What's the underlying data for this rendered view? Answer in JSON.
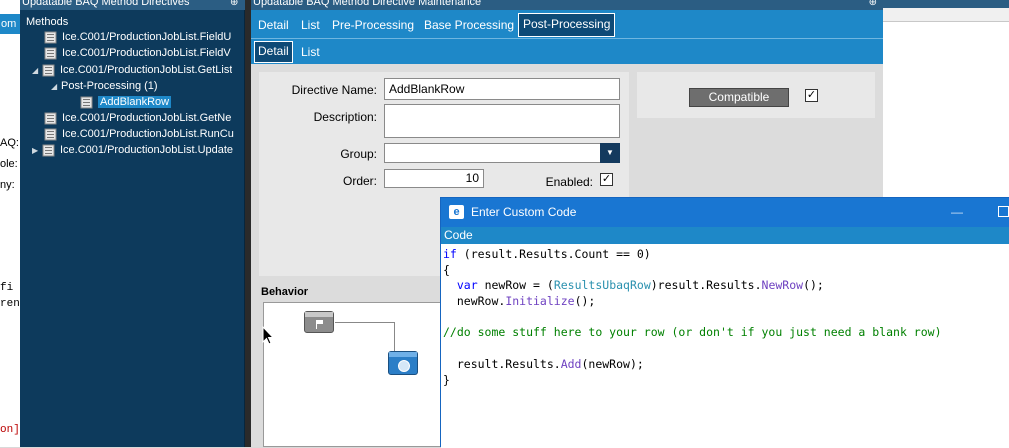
{
  "left_window": {
    "tab_fragment": "om",
    "labels": [
      "AQ:",
      "ole:",
      "ny:"
    ],
    "code_fragments": [
      "fi",
      "ren",
      "on]"
    ]
  },
  "methods_panel": {
    "title": "Updatable BAQ Method Directives",
    "pin": "⊕",
    "root_label": "Methods",
    "items": [
      {
        "label": "Ice.C001/ProductionJobList.FieldU"
      },
      {
        "label": "Ice.C001/ProductionJobList.FieldV"
      },
      {
        "label": "Ice.C001/ProductionJobList.GetList"
      },
      {
        "label": "Post-Processing (1)"
      },
      {
        "label": "AddBlankRow"
      },
      {
        "label": "Ice.C001/ProductionJobList.GetNe"
      },
      {
        "label": "Ice.C001/ProductionJobList.RunCu"
      },
      {
        "label": "Ice.C001/ProductionJobList.Update"
      }
    ]
  },
  "main_window": {
    "title": "Updatable BAQ Method Directive Maintenance",
    "pin": "⊕",
    "tabs_top": [
      "Detail",
      "List",
      "Pre-Processing",
      "Base Processing",
      "Post-Processing"
    ],
    "tabs_sub": [
      "Detail",
      "List"
    ],
    "form": {
      "directive_name_label": "Directive Name:",
      "directive_name_value": "AddBlankRow",
      "description_label": "Description:",
      "description_value": "",
      "group_label": "Group:",
      "group_value": "",
      "order_label": "Order:",
      "order_value": "10",
      "enabled_label": "Enabled:",
      "enabled_checked": true
    },
    "compatible": {
      "button_label": "Compatible",
      "checked": true
    },
    "behavior_label": "Behavior"
  },
  "dialog": {
    "title": "Enter Custom Code",
    "icon": "e",
    "minimize": "—",
    "code_header": "Code",
    "code": {
      "l1": {
        "kw": "if",
        "rest": " (result.Results.Count == 0)"
      },
      "l2": "{",
      "l3": {
        "indent": "  ",
        "kw": "var",
        "var": " newRow = (",
        "type": "ResultsUbaqRow",
        "mid": ")result.Results.",
        "method": "NewRow",
        "end": "();"
      },
      "l4": {
        "indent": "  newRow.",
        "method": "Initialize",
        "end": "();"
      },
      "l5": "//do some stuff here to your row (or don't if you just need a blank row)",
      "l6": {
        "indent": "  result.Results.",
        "method": "Add",
        "end": "(newRow);"
      },
      "l7": "}"
    }
  },
  "colors": {
    "accent": "#1e88c8",
    "tree_bg": "#0d3a5c",
    "dialog_title": "#1976d2"
  }
}
